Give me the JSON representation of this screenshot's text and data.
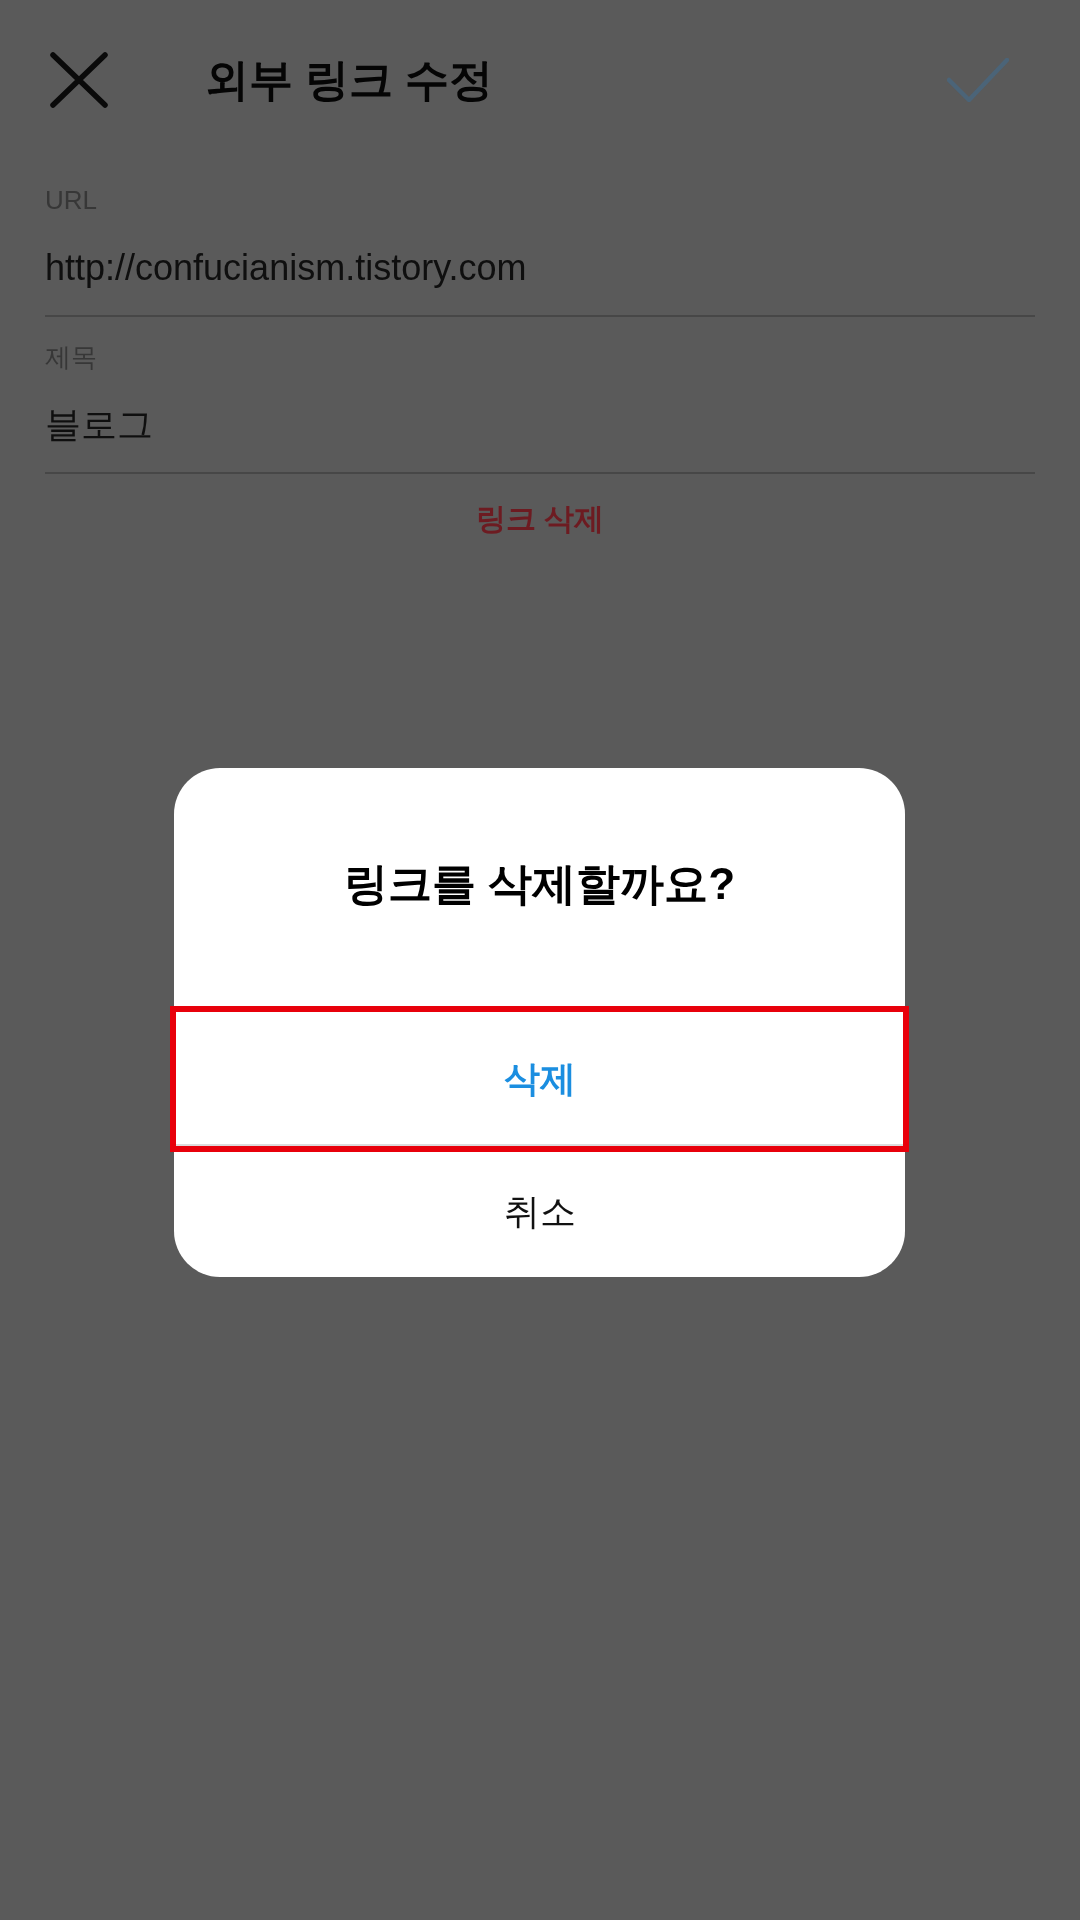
{
  "header": {
    "title": "외부 링크 수정"
  },
  "fields": [
    {
      "label": "URL",
      "value": "http://confucianism.tistory.com"
    },
    {
      "label": "제목",
      "value": "블로그"
    }
  ],
  "delete_link": {
    "label": "링크 삭제"
  },
  "dialog": {
    "title": "링크를 삭제할까요?",
    "buttons": [
      {
        "label": "삭제",
        "kind": "destructive",
        "highlighted": true
      },
      {
        "label": "취소",
        "kind": "cancel",
        "highlighted": false
      }
    ]
  }
}
